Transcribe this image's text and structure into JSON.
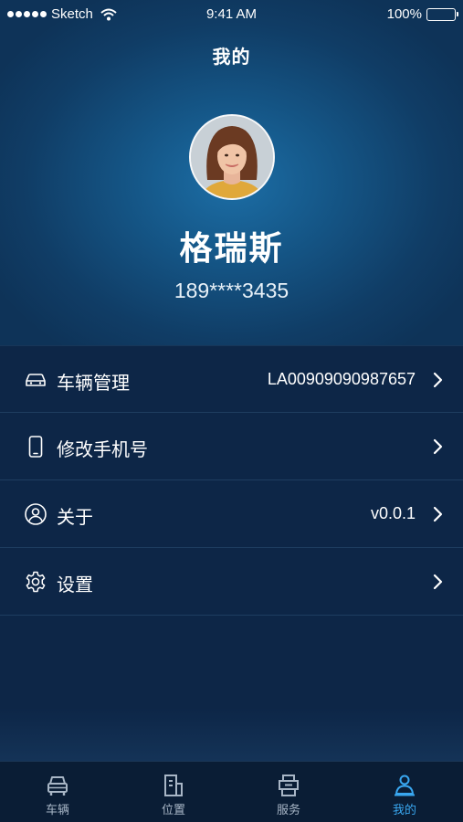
{
  "status_bar": {
    "carrier": "Sketch",
    "time": "9:41 AM",
    "battery": "100%",
    "icons": [
      "signal-dots-icon",
      "wifi-icon",
      "battery-icon"
    ]
  },
  "header": {
    "title": "我的"
  },
  "profile": {
    "avatar": "user-avatar-photo",
    "name": "格瑞斯",
    "phone": "189****3435"
  },
  "menu": {
    "items": [
      {
        "label": "车辆管理",
        "value": "LA00909090987657",
        "icon": "car-icon"
      },
      {
        "label": "修改手机号",
        "value": "",
        "icon": "phone-icon"
      },
      {
        "label": "关于",
        "value": "v0.0.1",
        "icon": "user-circle-icon"
      },
      {
        "label": "设置",
        "value": "",
        "icon": "gear-icon"
      }
    ]
  },
  "tabbar": {
    "tabs": [
      {
        "label": "车辆",
        "icon": "car-front-icon",
        "active": false
      },
      {
        "label": "位置",
        "icon": "building-icon",
        "active": false
      },
      {
        "label": "服务",
        "icon": "printer-icon",
        "active": false
      },
      {
        "label": "我的",
        "icon": "person-icon",
        "active": true
      }
    ]
  },
  "colors": {
    "background": "#0d2646",
    "header_highlight": "#1c6ea6",
    "tab_active": "#39a7f0",
    "tab_inactive": "#a8b6c6"
  }
}
